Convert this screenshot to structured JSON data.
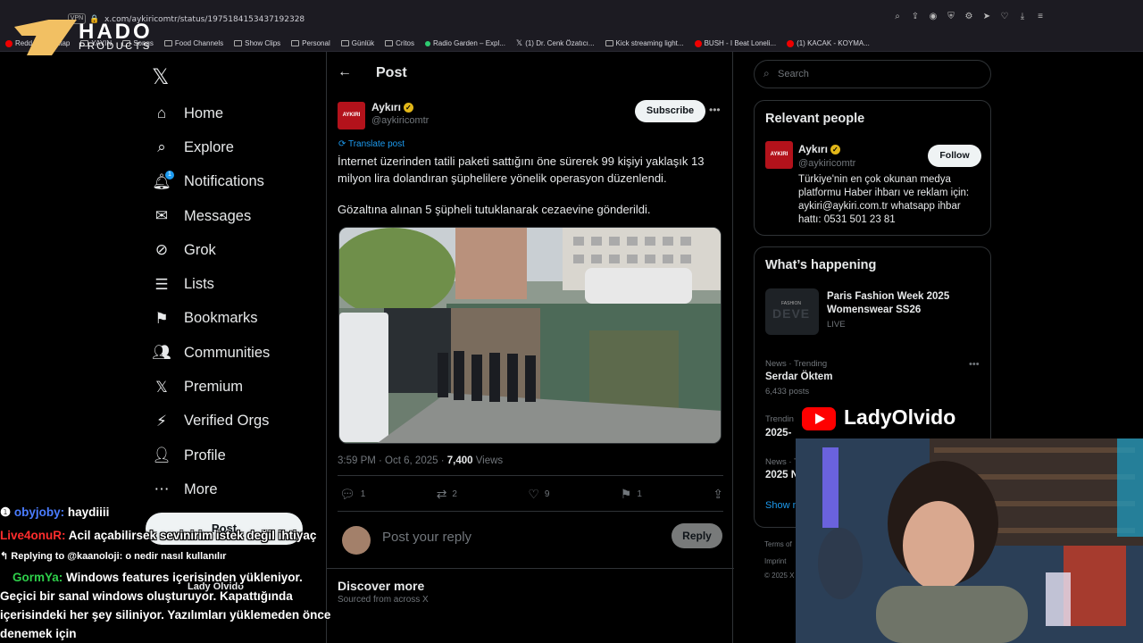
{
  "browser": {
    "url": "x.com/aykiricomtr/status/1975184153437192328",
    "vpn_label": "VPN",
    "bookmarks": [
      "Redd",
      "Kitap",
      "YAYIN",
      "Songs",
      "Food Channels",
      "Show Clips",
      "Personal",
      "Günlük",
      "Critos",
      "Radio Garden – Expl...",
      "(1) Dr. Cenk Özatıcı...",
      "Kick streaming light...",
      "BUSH - I Beat Loneli...",
      "(1) KACAK - KOYMA..."
    ]
  },
  "overlay_logo": {
    "title": "HADO",
    "subtitle": "PRODUCTS"
  },
  "nav": {
    "items": [
      {
        "label": "Home",
        "icon": "home-icon"
      },
      {
        "label": "Explore",
        "icon": "search-icon"
      },
      {
        "label": "Notifications",
        "icon": "bell-icon",
        "badge": "1"
      },
      {
        "label": "Messages",
        "icon": "envelope-icon"
      },
      {
        "label": "Grok",
        "icon": "grok-icon"
      },
      {
        "label": "Lists",
        "icon": "list-icon"
      },
      {
        "label": "Bookmarks",
        "icon": "bookmark-icon"
      },
      {
        "label": "Communities",
        "icon": "people-icon"
      },
      {
        "label": "Premium",
        "icon": "x-icon"
      },
      {
        "label": "Verified Orgs",
        "icon": "lightning-icon"
      },
      {
        "label": "Profile",
        "icon": "person-icon"
      },
      {
        "label": "More",
        "icon": "more-icon"
      }
    ],
    "post_button": "Post",
    "account_name": "Lady Olvido"
  },
  "post": {
    "header": "Post",
    "author": "Aykırı",
    "avatar_text": "AYKIRI",
    "handle": "@aykiricomtr",
    "subscribe": "Subscribe",
    "translate": "Translate post",
    "paragraph1": "İnternet üzerinden tatili paketi sattığını öne sürerek 99 kişiyi yaklaşık 13 milyon lira dolandıran şüphelilere yönelik operasyon düzenlendi.",
    "paragraph2": "Gözaltına alınan 5 şüpheli tutuklanarak cezaevine gönderildi.",
    "time": "3:59 PM · Oct 6, 2025 · ",
    "views_count": "7,400",
    "views_label": " Views",
    "stats": {
      "replies": "1",
      "reposts": "2",
      "likes": "9",
      "bookmarks": "1"
    },
    "reply_placeholder": "Post your reply",
    "reply_button": "Reply",
    "discover_title": "Discover more",
    "discover_sub": "Sourced from across X"
  },
  "sidebar": {
    "search_placeholder": "Search",
    "relevant_title": "Relevant people",
    "person": {
      "name": "Aykırı",
      "handle": "@aykiricomtr",
      "follow": "Follow",
      "bio": "Türkiye'nin en çok okunan medya platformu Haber ihbarı ve reklam için: aykiri@aykiri.com.tr whatsapp ihbar hattı: 0531 501 23 81"
    },
    "happening_title": "What’s happening",
    "trend1": {
      "title": "Paris Fashion Week 2025 Womenswear SS26",
      "status": "LIVE",
      "thumb": "FASHION"
    },
    "trend2": {
      "meta": "News · Trending",
      "title": "Serdar Öktem",
      "posts": "6,433 posts"
    },
    "trend3": {
      "meta": "Trendin",
      "title": "2025-"
    },
    "trend4": {
      "meta": "News · T",
      "title": "2025 N"
    },
    "show_more": "Show m",
    "footer1": "Terms of",
    "footer2": "Imprint",
    "footer3": "© 2025 X"
  },
  "stream": {
    "channel": "LadyOlvido",
    "chat": [
      {
        "user": "obyjoby:",
        "msg": " haydiiii"
      },
      {
        "user": "Live4onuR:",
        "msg": " Acil açabilirsek sevinirim istek değil ihtiyaç"
      },
      {
        "reply": "Replying to @kaanoloji: o nedir nasıl kullanılır"
      },
      {
        "user": "GormYa:",
        "msg": " Windows features içerisinden yükleniyor."
      },
      {
        "line": "Geçici bir sanal windows oluşturuyor. Kapattığında"
      },
      {
        "line": "içerisindeki her şey siliniyor. Yazılımları yüklemeden önce"
      },
      {
        "line": "denemek için"
      }
    ]
  }
}
